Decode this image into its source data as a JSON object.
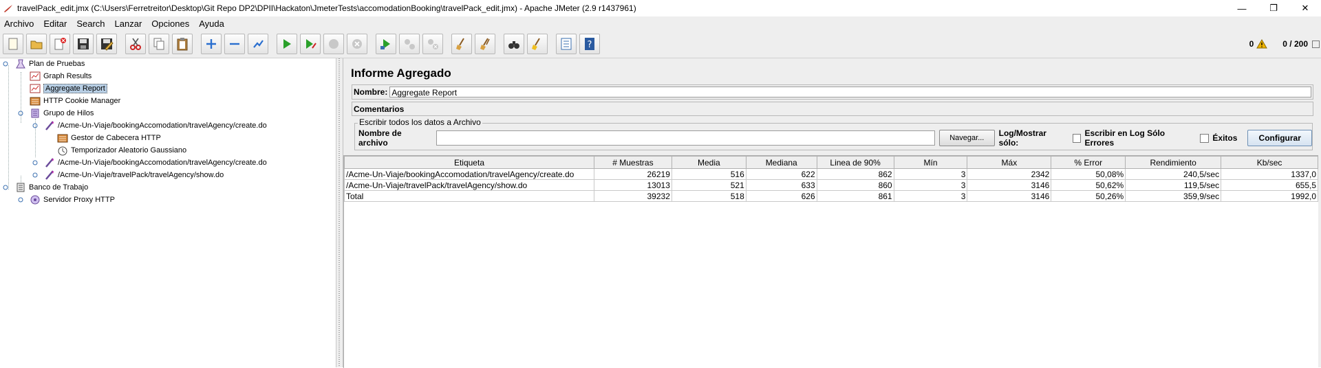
{
  "window": {
    "title": "travelPack_edit.jmx (C:\\Users\\Ferretreitor\\Desktop\\Git Repo DP2\\DPII\\Hackaton\\JmeterTests\\accomodationBooking\\travelPack_edit.jmx) - Apache JMeter (2.9 r1437961)",
    "minimize": "—",
    "restore": "❐",
    "close": "✕"
  },
  "menu": {
    "items": [
      {
        "label": "Archivo"
      },
      {
        "label": "Editar"
      },
      {
        "label": "Search"
      },
      {
        "label": "Lanzar"
      },
      {
        "label": "Opciones"
      },
      {
        "label": "Ayuda"
      }
    ]
  },
  "toolbar": {
    "error_count": "0",
    "threads": "0 / 200",
    "icons": [
      "new-icon",
      "open-icon",
      "close-plan-icon",
      "save-icon",
      "save-as-icon",
      "cut-icon",
      "copy-icon",
      "paste-icon",
      "expand-icon",
      "collapse-icon",
      "toggle-icon",
      "start-icon",
      "start-no-pause-icon",
      "stop-icon",
      "shutdown-icon",
      "remote-start-icon",
      "remote-stop-icon",
      "remote-shutdown-icon",
      "clear-icon",
      "clear-all-icon",
      "search-icon",
      "reset-search-icon",
      "function-helper-icon",
      "help-icon"
    ]
  },
  "tree": {
    "nodes": [
      {
        "label": "Plan de Pruebas"
      },
      {
        "label": "Graph Results"
      },
      {
        "label": "Aggregate Report"
      },
      {
        "label": "HTTP Cookie Manager"
      },
      {
        "label": "Grupo de Hilos"
      },
      {
        "label": "/Acme-Un-Viaje/bookingAccomodation/travelAgency/create.do"
      },
      {
        "label": "Gestor de Cabecera HTTP"
      },
      {
        "label": "Temporizador Aleatorio Gaussiano"
      },
      {
        "label": "/Acme-Un-Viaje/bookingAccomodation/travelAgency/create.do"
      },
      {
        "label": "/Acme-Un-Viaje/travelPack/travelAgency/show.do"
      },
      {
        "label": "Banco de Trabajo"
      },
      {
        "label": "Servidor Proxy HTTP"
      }
    ]
  },
  "panel": {
    "title": "Informe Agregado",
    "name_label": "Nombre:",
    "name_value": "Aggregate Report",
    "comments_label": "Comentarios",
    "file_group_title": "Escribir todos los datos a Archivo",
    "file_label": "Nombre de archivo",
    "file_value": "",
    "browse_label": "Navegar...",
    "log_label": "Log/Mostrar sólo:",
    "errors_only_label": "Escribir en Log Sólo Errores",
    "success_label": "Éxitos",
    "configure_label": "Configurar"
  },
  "table": {
    "columns": [
      "Etiqueta",
      "# Muestras",
      "Media",
      "Mediana",
      "Linea de 90%",
      "Mín",
      "Máx",
      "% Error",
      "Rendimiento",
      "Kb/sec"
    ],
    "rows": [
      [
        "/Acme-Un-Viaje/bookingAccomodation/travelAgency/create.do",
        "26219",
        "516",
        "622",
        "862",
        "3",
        "2342",
        "50,08%",
        "240,5/sec",
        "1337,0"
      ],
      [
        "/Acme-Un-Viaje/travelPack/travelAgency/show.do",
        "13013",
        "521",
        "633",
        "860",
        "3",
        "3146",
        "50,62%",
        "119,5/sec",
        "655,5"
      ],
      [
        "Total",
        "39232",
        "518",
        "626",
        "861",
        "3",
        "3146",
        "50,26%",
        "359,9/sec",
        "1992,0"
      ]
    ]
  },
  "colors": {
    "selection": "#b8cfe5",
    "panel_bg": "#eeeeee",
    "warning": "#f0b400"
  }
}
